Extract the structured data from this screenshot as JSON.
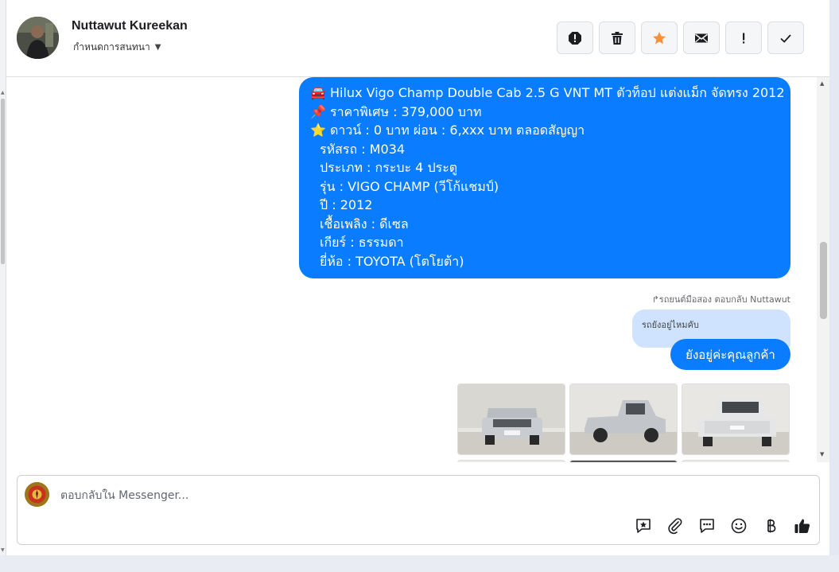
{
  "header": {
    "contact_name": "Nuttawut Kureekan",
    "status_label": "กำหนดการสนทนา"
  },
  "toolbar": {
    "buttons": [
      "report-spam",
      "delete",
      "star",
      "mail",
      "mark-important",
      "done"
    ]
  },
  "messages": {
    "listing": [
      "🚘 Hilux Vigo Champ Double Cab 2.5 G VNT MT ตัวท็อป แต่งแม็ก จัดทรง 2012",
      "📌 ราคาพิเศษ : 379,000 บาท",
      "⭐ ดาวน์ : 0 บาท ผ่อน : 6,xxx บาท ตลอดสัญญา",
      "รหัสรถ : M034",
      "ประเภท : กระบะ 4 ประตู",
      "รุ่น : VIGO CHAMP (วีโก้แชมป์)",
      "ปี : 2012",
      "เชื้อเพลิง : ดีเซล",
      "เกียร์ : ธรรมดา",
      "ยี่ห้อ : TOYOTA (โตโยต้า)"
    ],
    "reply_note": "↱รถยนต์มือสอง ตอบกลับ Nuttawut",
    "quoted_text": "รถยังอยู่ไหมคับ",
    "reply_text": "ยังอยู่ค่ะคุณลูกค้า"
  },
  "composer": {
    "placeholder": "ตอบกลับใน Messenger..."
  },
  "colors": {
    "bubble_blue": "#0a7cff",
    "quoted_bg": "#cfe3ff",
    "star_orange": "#f7923a"
  }
}
